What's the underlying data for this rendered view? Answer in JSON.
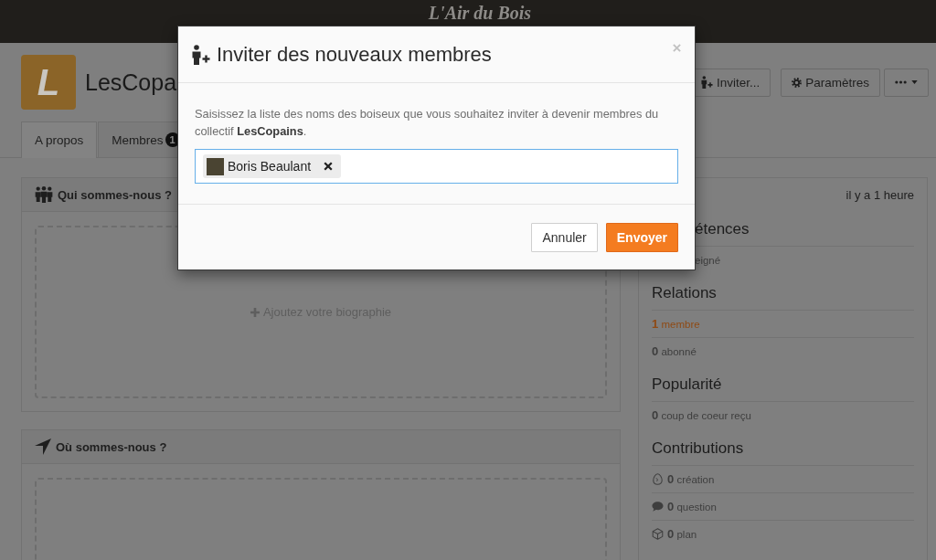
{
  "header": {
    "logo": "L'Air du Bois"
  },
  "group": {
    "avatar_letter": "L",
    "name": "LesCopa",
    "actions": [
      {
        "kind": "invite",
        "label": "Inviter..."
      },
      {
        "kind": "settings",
        "label": "Paramètres"
      },
      {
        "kind": "more"
      }
    ]
  },
  "tabs": [
    {
      "label": "A propos",
      "selected": true
    },
    {
      "label": "Membres",
      "badge": "1",
      "selected": false
    }
  ],
  "panels": [
    {
      "kind": "bio",
      "title": "Qui sommes-nous ?",
      "add_label": "Ajoutez votre biographie"
    },
    {
      "kind": "location",
      "title": "Où sommes-nous ?"
    }
  ],
  "sidebar": {
    "updated": "il y a 1 heure",
    "sections": [
      {
        "heading": "étences",
        "items": [
          {
            "kind": "text",
            "text": "eigné"
          }
        ]
      },
      {
        "heading": "Relations",
        "items": [
          {
            "kind": "link",
            "text": "**1** membre"
          },
          {
            "kind": "text",
            "text": "**0** abonné"
          }
        ]
      },
      {
        "heading": "Popularité",
        "items": [
          {
            "kind": "text",
            "text": "**0** coup de coeur reçu"
          }
        ]
      },
      {
        "heading": "Contributions",
        "items": [
          {
            "kind": "stat",
            "text": "**0** création"
          },
          {
            "kind": "stat",
            "text": "**0** question"
          },
          {
            "kind": "stat",
            "text": "**0** plan"
          }
        ]
      }
    ]
  },
  "modal": {
    "title": "Inviter des nouveaux membres",
    "message": "Saisissez la liste des noms des boiseux que vous souhaitez inviter à devenir membres du collectif **LesCopains**.",
    "field": {
      "focused": true,
      "tokens": [
        {
          "name": "Boris Beaulant"
        }
      ]
    },
    "buttons": [
      {
        "kind": "secondary",
        "label": "Annuler"
      },
      {
        "kind": "primary",
        "label": "Envoyer"
      }
    ]
  }
}
